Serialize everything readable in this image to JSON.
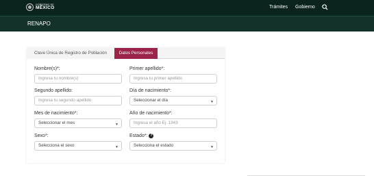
{
  "header": {
    "logo_small": "GOBIERNO DE",
    "logo_big": "MÉXICO",
    "nav": {
      "tramites": "Trámites",
      "gobierno": "Gobierno"
    }
  },
  "subheader": {
    "title": "RENAPO"
  },
  "tabs": [
    {
      "label": "Clave Única de Registro de Población",
      "active": false
    },
    {
      "label": "Datos Personales",
      "active": true
    }
  ],
  "form": {
    "nombre": {
      "label": "Nombre(s)*:",
      "placeholder": "Ingresa tu nombre(s)"
    },
    "primer_apellido": {
      "label": "Primer apellido*:",
      "placeholder": "Ingresa tu primer apellido"
    },
    "segundo_apellido": {
      "label": "Segundo apellido:",
      "placeholder": "Ingresa tu segundo apellido"
    },
    "dia": {
      "label": "Día de nacimiento*:",
      "selected": "Seleccionar el día"
    },
    "mes": {
      "label": "Mes de nacimiento*:",
      "selected": "Seleccionar el mes"
    },
    "anio": {
      "label": "Año de nacimiento*:",
      "placeholder": "Ingresa el año Ej. 1943"
    },
    "sexo": {
      "label": "Sexo*:",
      "selected": "Selecciona el sexo"
    },
    "estado": {
      "label": "Estado*:",
      "selected": "Selecciona el estado"
    }
  },
  "colors": {
    "header_bg": "#0b231e",
    "subheader_bg": "#13322b",
    "active_tab": "#9d2449"
  },
  "icons": {
    "search": "search-icon",
    "help": "question-circle-icon",
    "dropdown": "chevron-down-icon"
  }
}
